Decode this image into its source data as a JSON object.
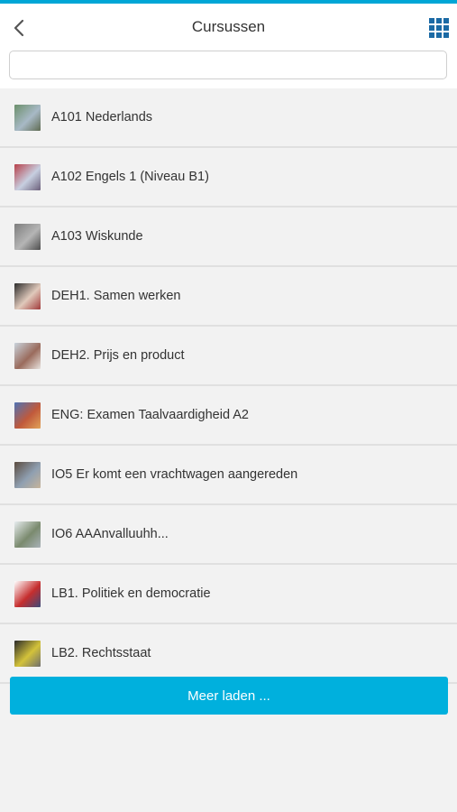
{
  "header": {
    "title": "Cursussen",
    "back_icon": "chevron-left-icon",
    "menu_icon": "grid-icon"
  },
  "search": {
    "value": "",
    "placeholder": ""
  },
  "courses": [
    {
      "label": "A101 Nederlands",
      "thumb_colors": [
        "#6b8f6a",
        "#a8b9c6",
        "#5f6b52"
      ]
    },
    {
      "label": "A102 Engels 1 (Niveau B1)",
      "thumb_colors": [
        "#b7404a",
        "#c7cfe0",
        "#6b5f7a"
      ]
    },
    {
      "label": "A103 Wiskunde",
      "thumb_colors": [
        "#7d7d7d",
        "#b5b5b5",
        "#4d4d4d"
      ]
    },
    {
      "label": "DEH1. Samen werken",
      "thumb_colors": [
        "#2c2c2c",
        "#e0c9bb",
        "#a03a3a"
      ]
    },
    {
      "label": "DEH2. Prijs en product",
      "thumb_colors": [
        "#c9d3dc",
        "#9a6b5c",
        "#e7e2de"
      ]
    },
    {
      "label": "ENG: Examen Taalvaardigheid A2",
      "thumb_colors": [
        "#4f73b5",
        "#c0593b",
        "#e1a35a"
      ]
    },
    {
      "label": "IO5 Er komt een vrachtwagen aangereden",
      "thumb_colors": [
        "#5b4b3f",
        "#8f9fb1",
        "#c6b49b"
      ]
    },
    {
      "label": "IO6 AAAnvalluuhh...",
      "thumb_colors": [
        "#e7ecef",
        "#7a8a6e",
        "#a9b2b8"
      ]
    },
    {
      "label": "LB1. Politiek en democratie",
      "thumb_colors": [
        "#ffffff",
        "#c62e2e",
        "#3b4a7a"
      ]
    },
    {
      "label": "LB2. Rechtsstaat",
      "thumb_colors": [
        "#2a2a2a",
        "#d3c23a",
        "#6e6e6e"
      ]
    }
  ],
  "load_more": {
    "label": "Meer laden ..."
  },
  "colors": {
    "accent": "#00b0dd",
    "topbar": "#00a6d6",
    "icon": "#1b6aa5"
  }
}
